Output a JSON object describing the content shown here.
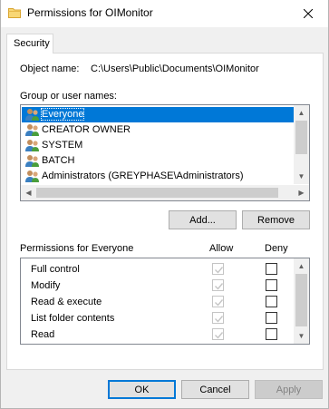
{
  "window": {
    "title": "Permissions for OIMonitor"
  },
  "tabs": [
    {
      "label": "Security"
    }
  ],
  "object": {
    "label": "Object name:",
    "value": "C:\\Users\\Public\\Documents\\OIMonitor"
  },
  "groups": {
    "label": "Group or user names:",
    "items": [
      {
        "name": "Everyone"
      },
      {
        "name": "CREATOR OWNER"
      },
      {
        "name": "SYSTEM"
      },
      {
        "name": "BATCH"
      },
      {
        "name": "Administrators (GREYPHASE\\Administrators)"
      }
    ]
  },
  "buttons": {
    "add": "Add...",
    "remove": "Remove",
    "ok": "OK",
    "cancel": "Cancel",
    "apply": "Apply"
  },
  "permissions": {
    "label": "Permissions for Everyone",
    "allow_header": "Allow",
    "deny_header": "Deny",
    "rows": [
      {
        "name": "Full control",
        "allow": true,
        "deny": false
      },
      {
        "name": "Modify",
        "allow": true,
        "deny": false
      },
      {
        "name": "Read & execute",
        "allow": true,
        "deny": false
      },
      {
        "name": "List folder contents",
        "allow": true,
        "deny": false
      },
      {
        "name": "Read",
        "allow": true,
        "deny": false
      }
    ]
  },
  "colors": {
    "selection": "#0078d7",
    "accent": "#0078d7"
  }
}
